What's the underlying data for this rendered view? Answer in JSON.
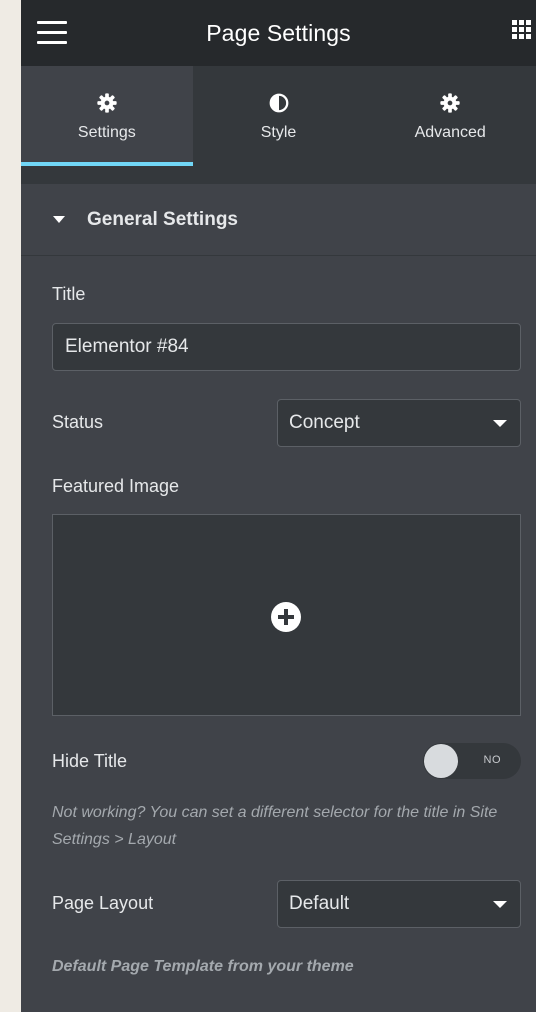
{
  "header": {
    "title": "Page Settings",
    "menu_icon": "hamburger-icon",
    "apps_icon": "grid-icon"
  },
  "tabs": [
    {
      "label": "Settings",
      "icon": "gear-icon",
      "active": true
    },
    {
      "label": "Style",
      "icon": "half-circle-icon",
      "active": false
    },
    {
      "label": "Advanced",
      "icon": "gear-icon",
      "active": false
    }
  ],
  "section": {
    "title": "General Settings",
    "expanded": true
  },
  "fields": {
    "title": {
      "label": "Title",
      "value": "Elementor #84"
    },
    "status": {
      "label": "Status",
      "value": "Concept"
    },
    "featured_image": {
      "label": "Featured Image",
      "add_icon": "plus-circle-icon"
    },
    "hide_title": {
      "label": "Hide Title",
      "state": "NO",
      "enabled": false
    },
    "hide_title_note": "Not working? You can set a different selector for the title in Site Settings > Layout",
    "page_layout": {
      "label": "Page Layout",
      "value": "Default"
    },
    "page_layout_note": "Default Page Template from your theme"
  },
  "colors": {
    "panel_bg": "#404349",
    "header_bg": "#26292c",
    "tab_bar_bg": "#34383c",
    "active_tab_indicator": "#71d7f7",
    "page_bg": "#efebe4"
  }
}
